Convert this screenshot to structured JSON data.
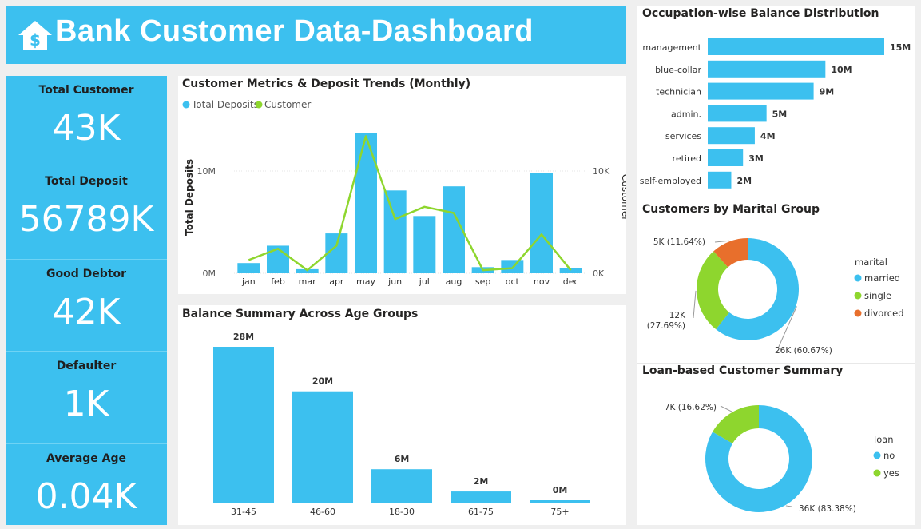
{
  "header": {
    "title": "Bank Customer Data-Dashboard",
    "icon": "bank-home-dollar-icon"
  },
  "kpis": [
    {
      "label": "Total Customer",
      "value": "43K"
    },
    {
      "label": "Total Deposit",
      "value": "56789K"
    },
    {
      "label": "Good Debtor",
      "value": "42K"
    },
    {
      "label": "Defaulter",
      "value": "1K"
    },
    {
      "label": "Average Age",
      "value": "0.04K"
    }
  ],
  "colors": {
    "primary": "#3cc0ef",
    "green": "#8ed62e",
    "orange": "#e86f2c",
    "text": "#252423"
  },
  "chart_data": [
    {
      "id": "monthly",
      "type": "bar+line",
      "title": "Customer Metrics & Deposit Trends (Monthly)",
      "legend": [
        "Total Deposits",
        "Customer"
      ],
      "ylabel": "Total Deposits",
      "y2label": "Customer",
      "yticks": [
        "10M",
        "0M"
      ],
      "y2ticks": [
        "10K",
        "0K"
      ],
      "ylim": [
        0,
        15000000
      ],
      "y2lim": [
        0,
        15000
      ],
      "categories": [
        "jan",
        "feb",
        "mar",
        "apr",
        "may",
        "jun",
        "jul",
        "aug",
        "sep",
        "oct",
        "nov",
        "dec"
      ],
      "series": [
        {
          "name": "Total Deposits",
          "values": [
            1000000,
            2700000,
            400000,
            3900000,
            13700000,
            8100000,
            5600000,
            8500000,
            600000,
            1300000,
            9800000,
            500000
          ]
        },
        {
          "name": "Customer",
          "values": [
            1300,
            2400,
            300,
            2700,
            13400,
            5300,
            6500,
            5900,
            300,
            500,
            3800,
            300
          ]
        }
      ]
    },
    {
      "id": "age",
      "type": "bar",
      "title": "Balance Summary Across Age Groups",
      "categories": [
        "31-45",
        "46-60",
        "18-30",
        "61-75",
        "75+"
      ],
      "values": [
        28,
        20,
        6,
        2,
        0.3
      ],
      "labels": [
        "28M",
        "20M",
        "6M",
        "2M",
        "0M"
      ],
      "ylim": [
        0,
        28
      ]
    },
    {
      "id": "occupation",
      "type": "bar",
      "orientation": "horizontal",
      "title": "Occupation-wise Balance Distribution",
      "categories": [
        "management",
        "blue-collar",
        "technician",
        "admin.",
        "services",
        "retired",
        "self-employed"
      ],
      "values": [
        15,
        10,
        9,
        5,
        4,
        3,
        2
      ],
      "labels": [
        "15M",
        "10M",
        "9M",
        "5M",
        "4M",
        "3M",
        "2M"
      ],
      "xlim": [
        0,
        15
      ]
    },
    {
      "id": "marital",
      "type": "pie",
      "title": "Customers by Marital Group",
      "legend_title": "marital",
      "slices": [
        {
          "name": "married",
          "value": 60.67,
          "label": "26K (60.67%)",
          "color": "#3cc0ef"
        },
        {
          "name": "single",
          "value": 27.69,
          "label": "12K (27.69%)",
          "color": "#8ed62e"
        },
        {
          "name": "divorced",
          "value": 11.64,
          "label": "5K (11.64%)",
          "color": "#e86f2c"
        }
      ]
    },
    {
      "id": "loan",
      "type": "pie",
      "title": "Loan-based Customer Summary",
      "legend_title": "loan",
      "slices": [
        {
          "name": "no",
          "value": 83.38,
          "label": "36K (83.38%)",
          "color": "#3cc0ef"
        },
        {
          "name": "yes",
          "value": 16.62,
          "label": "7K (16.62%)",
          "color": "#8ed62e"
        }
      ]
    }
  ]
}
